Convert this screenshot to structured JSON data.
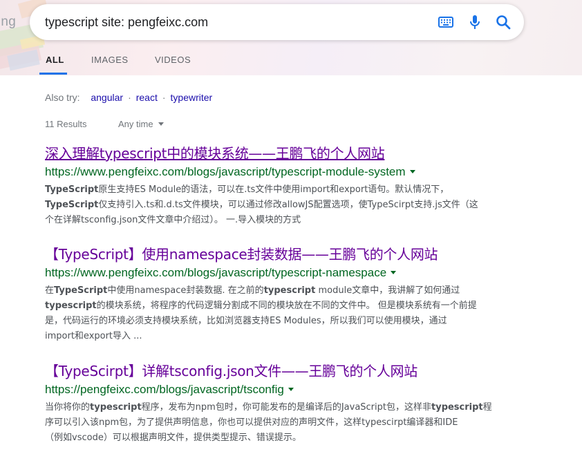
{
  "header": {
    "side_word": "ing",
    "search": {
      "query": "typescript site: pengfeixc.com"
    },
    "icons": [
      "keyboard-icon",
      "mic-icon",
      "search-icon"
    ],
    "tabs": [
      {
        "label": "ALL",
        "active": true
      },
      {
        "label": "IMAGES",
        "active": false
      },
      {
        "label": "VIDEOS",
        "active": false
      }
    ]
  },
  "also_try": {
    "label": "Also try:",
    "items": [
      "angular",
      "react",
      "typewriter"
    ]
  },
  "meta": {
    "results_count": "11 Results",
    "time_filter": "Any time"
  },
  "results": [
    {
      "title": "深入理解typescript中的模块系统——王鹏飞的个人网站",
      "url": "https://www.pengfeixc.com/blogs/javascript/typescript-module-system",
      "snippet": [
        [
          {
            "b": "TypeScript"
          },
          {
            "t": "原生支持ES Module的语法，可以在.ts文件中使用import和export语句。默认情况下，"
          }
        ],
        [
          {
            "b": "TypeScript"
          },
          {
            "t": "仅支持引入.ts和.d.ts文件模块，可以通过修改allowJS配置选项，使TypeScirpt支持.js文件（这"
          }
        ],
        [
          {
            "t": "个在详解tsconfig.json文件文章中介绍过）。 一.导入模块的方式"
          }
        ]
      ]
    },
    {
      "title": "【TypeScript】使用namespace封装数据——王鹏飞的个人网站",
      "url": "https://www.pengfeixc.com/blogs/javascript/typescript-namespace",
      "snippet": [
        [
          {
            "t": "在"
          },
          {
            "b": "TypeScript"
          },
          {
            "t": "中使用namespace封装数据. 在之前的"
          },
          {
            "b": "typescript"
          },
          {
            "t": " module文章中，我讲解了如何通过"
          }
        ],
        [
          {
            "b": "typescript"
          },
          {
            "t": "的模块系统，将程序的代码逻辑分割成不同的模块放在不同的文件中。 但是模块系统有一个前提"
          }
        ],
        [
          {
            "t": "是，代码运行的环境必须支持模块系统，比如浏览器支持ES Modules，所以我们可以使用模块，通过"
          }
        ],
        [
          {
            "t": "import和export导入 ..."
          }
        ]
      ]
    },
    {
      "title": "【TypeScirpt】详解tsconfig.json文件——王鹏飞的个人网站",
      "url": "https://pengfeixc.com/blogs/javascript/tsconfig",
      "snippet": [
        [
          {
            "t": "当你将你的"
          },
          {
            "b": "typescript"
          },
          {
            "t": "程序，发布为npm包时，你可能发布的是编译后的JavaScript包，这样非"
          },
          {
            "b": "typescript"
          },
          {
            "t": "程"
          }
        ],
        [
          {
            "t": "序可以引入该npm包，为了提供声明信息，你也可以提供对应的声明文件，这样typescirpt编译器和IDE"
          }
        ],
        [
          {
            "t": "（例如vscode）可以根据声明文件，提供类型提示、错误提示。"
          }
        ]
      ]
    }
  ],
  "colors": {
    "link_visited": "#660099",
    "url_green": "#006621",
    "chip_blue": "#1a0dab",
    "tab_indicator": "#1a73e8"
  }
}
